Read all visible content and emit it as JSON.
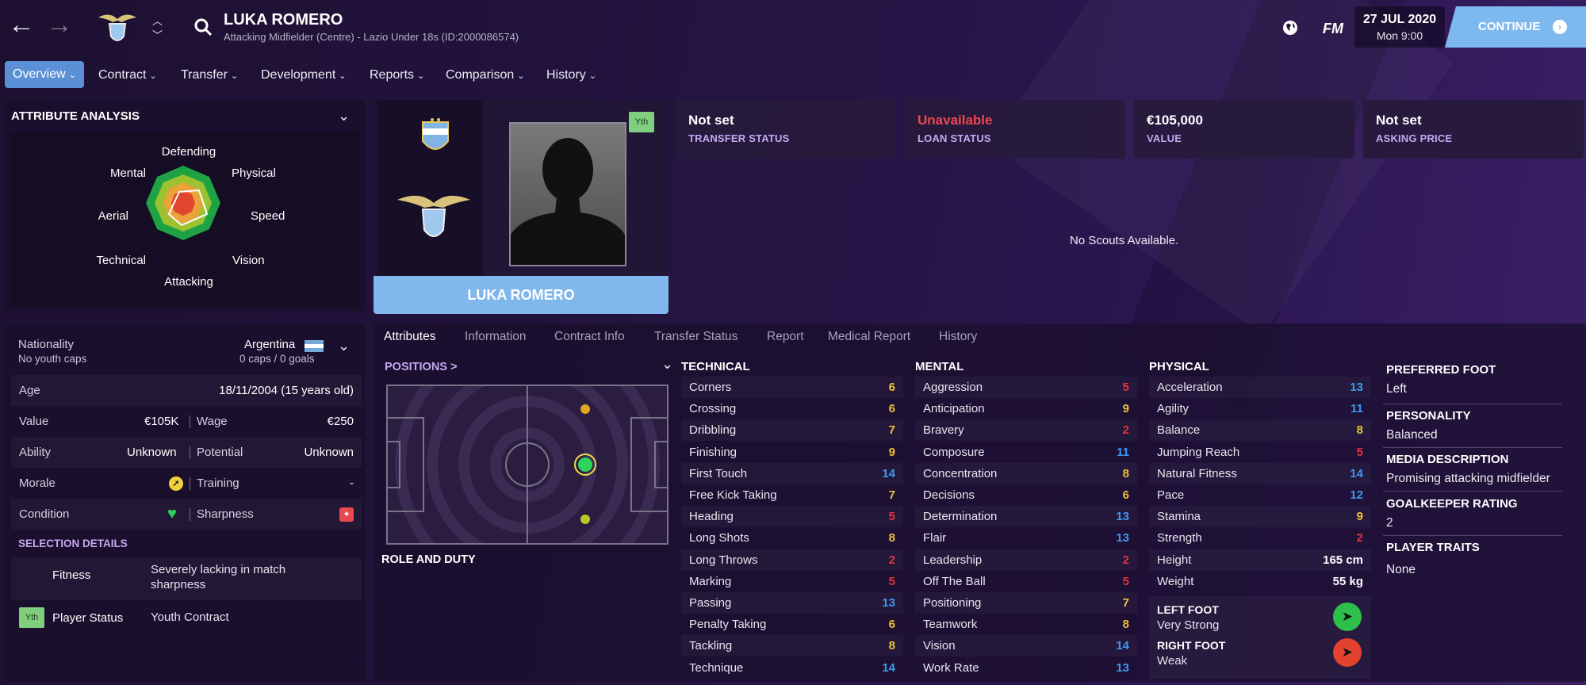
{
  "header": {
    "player_name": "LUKA ROMERO",
    "subtitle": "Attacking Midfielder (Centre) - Lazio Under 18s (ID:2000086574)",
    "logo_text": "FM",
    "date": "27 JUL 2020",
    "time": "Mon 9:00",
    "continue_label": "CONTINUE"
  },
  "nav": {
    "tabs": [
      "Overview",
      "Contract",
      "Transfer",
      "Development",
      "Reports",
      "Comparison",
      "History"
    ]
  },
  "attribute_analysis": {
    "title": "ATTRIBUTE ANALYSIS",
    "labels": [
      "Defending",
      "Physical",
      "Speed",
      "Vision",
      "Attacking",
      "Technical",
      "Aerial",
      "Mental"
    ]
  },
  "profile": {
    "yth_badge": "Yth",
    "name_banner": "LUKA ROMERO"
  },
  "status_cards": [
    {
      "value": "Not set",
      "label": "TRANSFER STATUS",
      "color": "#ffffff"
    },
    {
      "value": "Unavailable",
      "label": "LOAN STATUS",
      "color": "#f0474d"
    },
    {
      "value": "€105,000",
      "label": "VALUE",
      "color": "#ffffff"
    },
    {
      "value": "Not set",
      "label": "ASKING PRICE",
      "color": "#ffffff"
    }
  ],
  "scouts_message": "No Scouts Available.",
  "info": {
    "nationality_label": "Nationality",
    "nationality_value": "Argentina",
    "youth_caps": "No youth caps",
    "caps": "0 caps / 0 goals",
    "age_label": "Age",
    "age_value": "18/11/2004 (15 years old)",
    "value_label": "Value",
    "value_value": "€105K",
    "wage_label": "Wage",
    "wage_value": "€250",
    "ability_label": "Ability",
    "ability_value": "Unknown",
    "potential_label": "Potential",
    "potential_value": "Unknown",
    "morale_label": "Morale",
    "training_label": "Training",
    "training_value": "-",
    "condition_label": "Condition",
    "sharpness_label": "Sharpness",
    "selection_title": "SELECTION DETAILS",
    "fitness_label": "Fitness",
    "fitness_value": "Severely lacking in match sharpness",
    "player_status_badge": "Yth",
    "player_status_label": "Player Status",
    "player_status_value": "Youth Contract"
  },
  "subtabs": [
    "Attributes",
    "Information",
    "Contract Info",
    "Transfer Status",
    "Report",
    "Medical Report",
    "History"
  ],
  "positions": {
    "title": "POSITIONS >",
    "role_duty": "ROLE AND DUTY"
  },
  "technical": {
    "title": "TECHNICAL",
    "items": [
      {
        "name": "Corners",
        "value": "6"
      },
      {
        "name": "Crossing",
        "value": "6"
      },
      {
        "name": "Dribbling",
        "value": "7"
      },
      {
        "name": "Finishing",
        "value": "9"
      },
      {
        "name": "First Touch",
        "value": "14"
      },
      {
        "name": "Free Kick Taking",
        "value": "7"
      },
      {
        "name": "Heading",
        "value": "5"
      },
      {
        "name": "Long Shots",
        "value": "8"
      },
      {
        "name": "Long Throws",
        "value": "2"
      },
      {
        "name": "Marking",
        "value": "5"
      },
      {
        "name": "Passing",
        "value": "13"
      },
      {
        "name": "Penalty Taking",
        "value": "6"
      },
      {
        "name": "Tackling",
        "value": "8"
      },
      {
        "name": "Technique",
        "value": "14"
      }
    ]
  },
  "mental": {
    "title": "MENTAL",
    "items": [
      {
        "name": "Aggression",
        "value": "5"
      },
      {
        "name": "Anticipation",
        "value": "9"
      },
      {
        "name": "Bravery",
        "value": "2"
      },
      {
        "name": "Composure",
        "value": "11"
      },
      {
        "name": "Concentration",
        "value": "8"
      },
      {
        "name": "Decisions",
        "value": "6"
      },
      {
        "name": "Determination",
        "value": "13"
      },
      {
        "name": "Flair",
        "value": "13"
      },
      {
        "name": "Leadership",
        "value": "2"
      },
      {
        "name": "Off The Ball",
        "value": "5"
      },
      {
        "name": "Positioning",
        "value": "7"
      },
      {
        "name": "Teamwork",
        "value": "8"
      },
      {
        "name": "Vision",
        "value": "14"
      },
      {
        "name": "Work Rate",
        "value": "13"
      }
    ]
  },
  "physical": {
    "title": "PHYSICAL",
    "items": [
      {
        "name": "Acceleration",
        "value": "13"
      },
      {
        "name": "Agility",
        "value": "11"
      },
      {
        "name": "Balance",
        "value": "8"
      },
      {
        "name": "Jumping Reach",
        "value": "5"
      },
      {
        "name": "Natural Fitness",
        "value": "14"
      },
      {
        "name": "Pace",
        "value": "12"
      },
      {
        "name": "Stamina",
        "value": "9"
      },
      {
        "name": "Strength",
        "value": "2"
      },
      {
        "name": "Height",
        "value": "165 cm"
      },
      {
        "name": "Weight",
        "value": "55 kg"
      }
    ],
    "left_foot_label": "LEFT FOOT",
    "left_foot_value": "Very Strong",
    "right_foot_label": "RIGHT FOOT",
    "right_foot_value": "Weak"
  },
  "right_panel": {
    "preferred_foot_label": "PREFERRED FOOT",
    "preferred_foot_value": "Left",
    "personality_label": "PERSONALITY",
    "personality_value": "Balanced",
    "media_label": "MEDIA DESCRIPTION",
    "media_value": "Promising attacking midfielder",
    "gk_rating_label": "GOALKEEPER RATING",
    "gk_rating_value": "2",
    "traits_label": "PLAYER TRAITS",
    "traits_value": "None"
  },
  "colors": {
    "attr_low": "#e5333a",
    "attr_mid": "#f1c232",
    "attr_high": "#3d9af0",
    "accent": "#5b8fd6",
    "continue_bg": "#7db8ef"
  }
}
